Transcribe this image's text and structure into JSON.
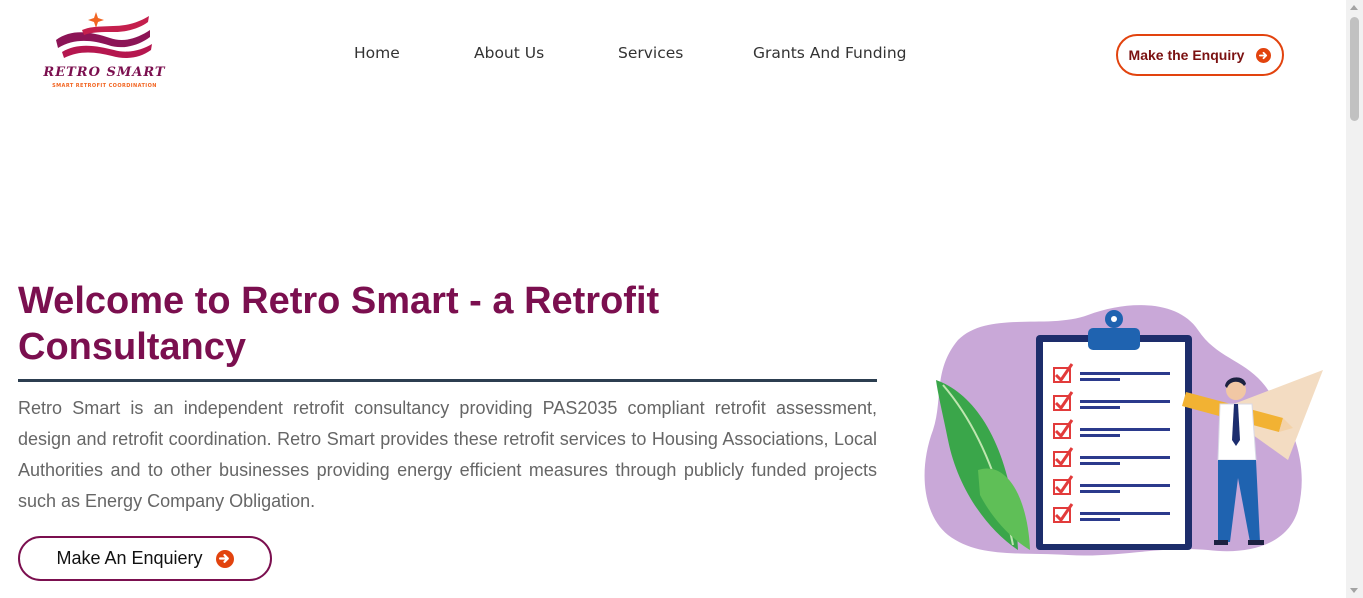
{
  "colors": {
    "brand": "#7b0f4f",
    "accent": "#e2430e",
    "rule": "#2c3e50",
    "body_text": "#666666"
  },
  "logo": {
    "title": "RETRO SMART",
    "subtitle": "SMART RETROFIT COORDINATION"
  },
  "nav": {
    "items": [
      {
        "label": "Home"
      },
      {
        "label": "About Us"
      },
      {
        "label": "Services"
      },
      {
        "label": "Grants And Funding"
      }
    ]
  },
  "header": {
    "enquiry_label": "Make the Enquiry",
    "enquiry_icon": "arrow-circle-right-icon"
  },
  "hero": {
    "title": "Welcome to Retro Smart - a Retrofit Consultancy",
    "body": "Retro Smart is an independent retrofit consultancy providing PAS2035 compliant retrofit assessment, design and retrofit coordination. Retro Smart provides these retrofit services to Housing Associations, Local Authorities and to other businesses providing energy efficient measures through publicly funded projects such as Energy Company Obligation.",
    "button_label": "Make An Enquiery",
    "button_icon": "arrow-circle-right-icon",
    "illustration": "checklist-clipboard-illustration"
  }
}
